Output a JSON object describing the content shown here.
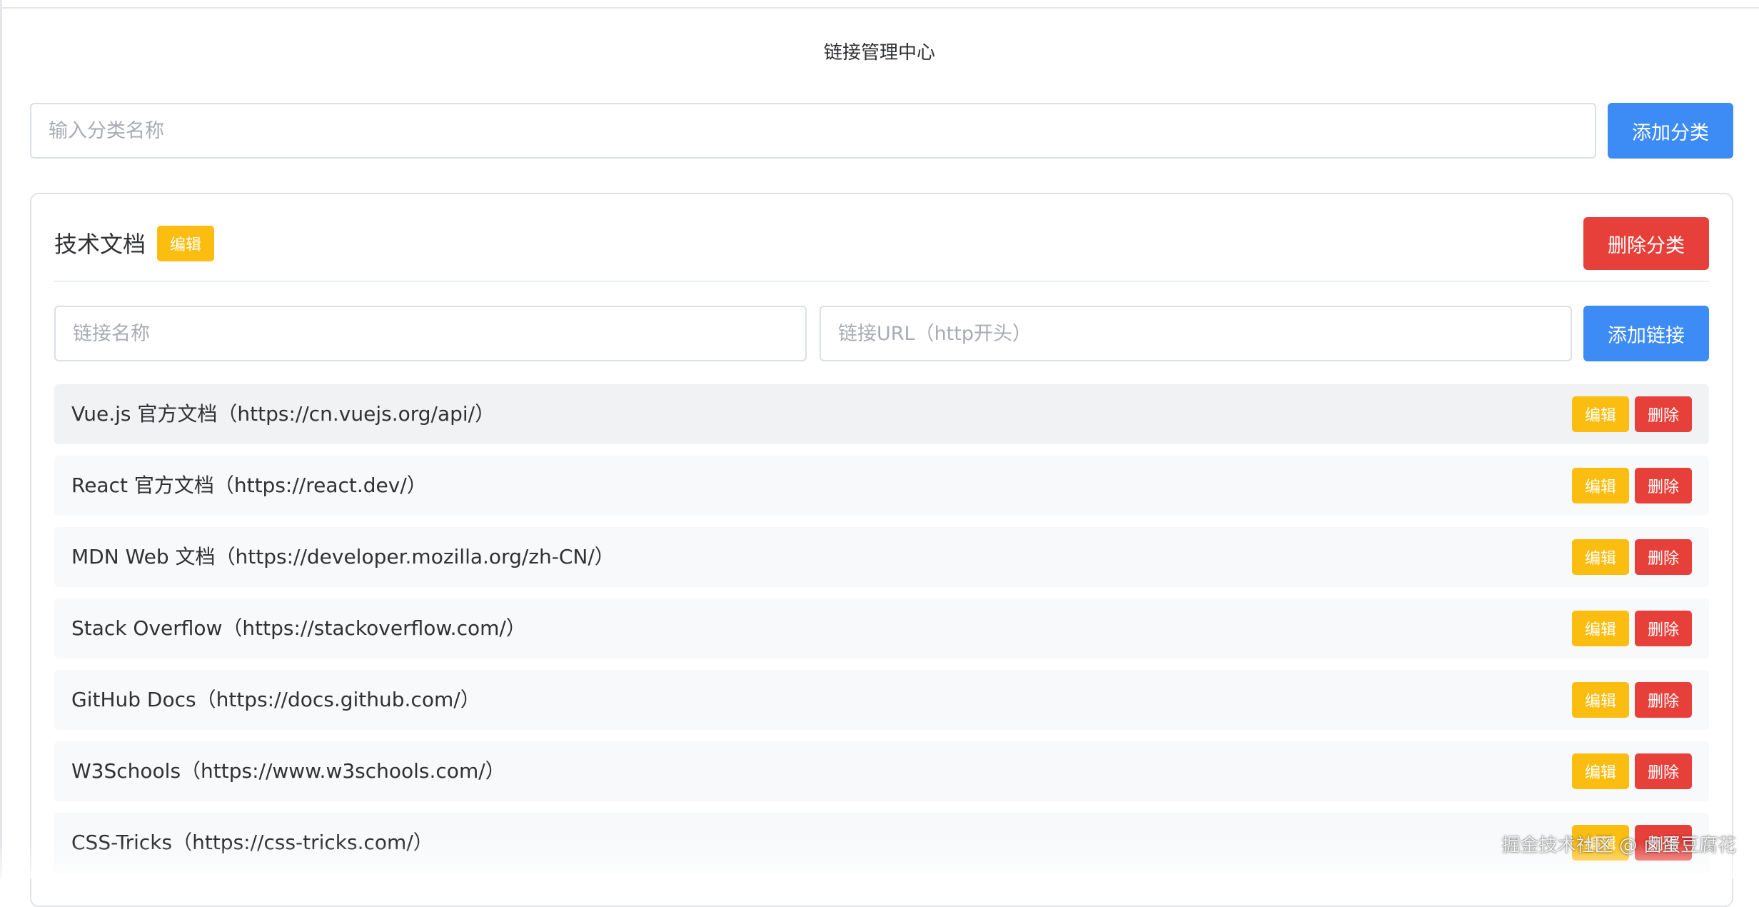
{
  "page": {
    "title": "链接管理中心"
  },
  "category_form": {
    "placeholder": "输入分类名称",
    "value": "",
    "add_label": "添加分类"
  },
  "category": {
    "name": "技术文档",
    "edit_label": "编辑",
    "delete_label": "删除分类",
    "link_name_placeholder": "链接名称",
    "link_url_placeholder": "链接URL（http开头）",
    "add_link_label": "添加链接",
    "links": [
      {
        "text": "Vue.js 官方文档（https://cn.vuejs.org/api/）",
        "edit": "编辑",
        "delete": "删除"
      },
      {
        "text": "React 官方文档（https://react.dev/）",
        "edit": "编辑",
        "delete": "删除"
      },
      {
        "text": "MDN Web 文档（https://developer.mozilla.org/zh-CN/）",
        "edit": "编辑",
        "delete": "删除"
      },
      {
        "text": "Stack Overflow（https://stackoverflow.com/）",
        "edit": "编辑",
        "delete": "删除"
      },
      {
        "text": "GitHub Docs（https://docs.github.com/）",
        "edit": "编辑",
        "delete": "删除"
      },
      {
        "text": "W3Schools（https://www.w3schools.com/）",
        "edit": "编辑",
        "delete": "删除"
      },
      {
        "text": "CSS-Tricks（https://css-tricks.com/）",
        "edit": "编辑",
        "delete": "删除"
      }
    ]
  },
  "colors": {
    "primary": "#3d8bf5",
    "danger": "#e7403a",
    "warning": "#fbbd10",
    "row_bg": "#f8f9fa"
  },
  "watermark": "掘金技术社区 @ 卤蛋豆腐花"
}
